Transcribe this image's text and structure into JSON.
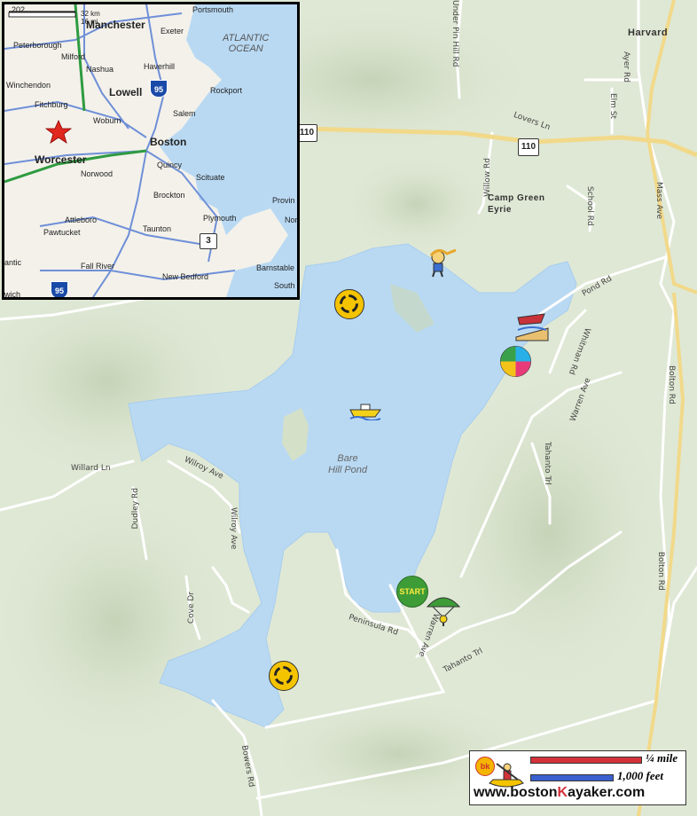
{
  "map": {
    "pond_name_line1": "Bare",
    "pond_name_line2": "Hill Pond",
    "towns": {
      "harvard": "Harvard",
      "camp_line1": "Camp Green",
      "camp_line2": "Eyrie"
    },
    "roads": {
      "under_pin_hill": "Under Pin Hill Rd",
      "ayer": "Ayer Rd",
      "elm": "Elm St",
      "lovers": "Lovers Ln",
      "willow": "Willow Rd",
      "school": "School Rd",
      "mass_ave": "Mass Ave",
      "pond": "Pond Rd",
      "whitman": "Whitman Rd",
      "warren": "Warren Ave",
      "bolton1": "Bolton Rd",
      "bolton2": "Bolton Rd",
      "tahanto1": "Tahanto Trl",
      "tahanto2": "Tahanto Trl",
      "willard": "Willard Ln",
      "wilroy1": "Wilroy Ave",
      "wilroy2": "Wilroy Ave",
      "dudley": "Dudley Rd",
      "cove": "Cove Dr",
      "peninsula": "Peninsula Rd",
      "bowers": "Bowers Rd",
      "warren2": "Warren Ave"
    },
    "shields": {
      "route110_a": "110",
      "route110_b": "110"
    },
    "start_label": "START",
    "icons": [
      "roundabout-icon",
      "roundabout-icon",
      "swimmer-icon",
      "boat-ramp-icon",
      "beach-ball-icon",
      "motorboat-icon",
      "parasail-icon"
    ],
    "colors": {
      "water": "#b9d9f3",
      "land": "#dfe8d5",
      "road": "#ffffff",
      "highway": "#f2d98a",
      "start": "#3e9c37"
    }
  },
  "inset": {
    "scale_km": "32 km",
    "scale_mi": "16 mi",
    "scale_num": "202",
    "ocean_line1": "ATLANTIC",
    "ocean_line2": "OCEAN",
    "cities": {
      "manchester": "Manchester",
      "portsmouth": "Portsmouth",
      "exeter": "Exeter",
      "peterborough": "Peterborough",
      "milford": "Milford",
      "nashua": "Nashua",
      "haverhill": "Haverhill",
      "lowell": "Lowell",
      "rockport": "Rockport",
      "winchendon": "Winchendon",
      "fitchburg": "Fitchburg",
      "woburn": "Woburn",
      "salem": "Salem",
      "boston": "Boston",
      "worcester": "Worcester",
      "quincy": "Quincy",
      "norwood": "Norwood",
      "scituate": "Scituate",
      "brockton": "Brockton",
      "plymouth": "Plymouth",
      "attleboro": "Attleboro",
      "pawtucket": "Pawtucket",
      "taunton": "Taunton",
      "provin": "Provin",
      "nor": "Nor",
      "fall_river": "Fall River",
      "barnstable": "Barnstable",
      "new_bedford": "New Bedford",
      "south": "South",
      "antic": "antic",
      "wich": "wich"
    },
    "shields": {
      "i95_north": "95",
      "i95_south": "95",
      "route3": "3"
    }
  },
  "scale": {
    "mile": "¼ mile",
    "feet": "1,000 feet",
    "site_pre": "www.boston",
    "site_k": "K",
    "site_post": "ayaker.com",
    "logo": "bk"
  }
}
